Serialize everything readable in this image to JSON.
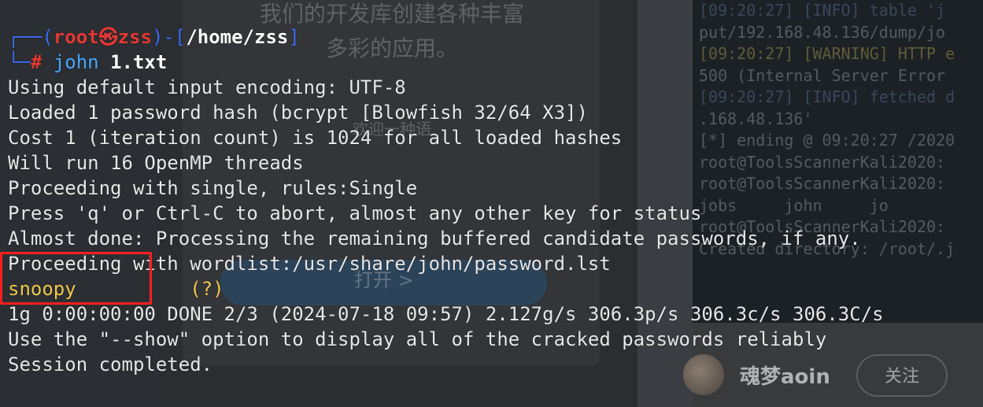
{
  "background": {
    "ghost_text_1": "我们的开发库创建各种丰富",
    "ghost_text_2": "多彩的应用。",
    "ghost_text_3": "欢迎一种语",
    "ghost_button": "打开 >",
    "right_terminal_lines": [
      "[09:20:27] [INFO] table 'j",
      "put/192.168.48.136/dump/jo",
      "[09:20:27] [WARNING] HTTP e",
      "500 (Internal Server Error",
      "[09:20:27] [INFO] fetched d",
      ".168.48.136'",
      "",
      "[*] ending @ 09:20:27 /2020",
      "",
      "root@ToolsScannerKali2020:",
      "root@ToolsScannerKali2020:",
      "jobs     john     jo",
      "root@ToolsScannerKali2020:",
      "Created directory: /root/.j"
    ],
    "social_name": "魂梦aoin",
    "follow_label": "关注"
  },
  "terminal": {
    "prompt_user": "root",
    "prompt_symbol": "㉿",
    "prompt_host": "zss",
    "prompt_path": "/home/zss",
    "command": "john",
    "command_arg": "1.txt",
    "output": [
      "Using default input encoding: UTF-8",
      "Loaded 1 password hash (bcrypt [Blowfish 32/64 X3])",
      "Cost 1 (iteration count) is 1024 for all loaded hashes",
      "Will run 16 OpenMP threads",
      "Proceeding with single, rules:Single",
      "Press 'q' or Ctrl-C to abort, almost any other key for status",
      "Almost done: Processing the remaining buffered candidate passwords, if any.",
      "Proceeding with wordlist:/usr/share/john/password.lst"
    ],
    "cracked_password": "snoopy",
    "cracked_suffix": "(?)",
    "output_after": [
      "1g 0:00:00:00 DONE 2/3 (2024-07-18 09:57) 2.127g/s 306.3p/s 306.3c/s 306.3C/s",
      "Use the \"--show\" option to display all of the cracked passwords reliably",
      "Session completed."
    ]
  },
  "colors": {
    "highlight": "#ff1f1f",
    "password": "#f2c94c",
    "prompt_user": "#e53935",
    "prompt_frame": "#3e6df0"
  }
}
